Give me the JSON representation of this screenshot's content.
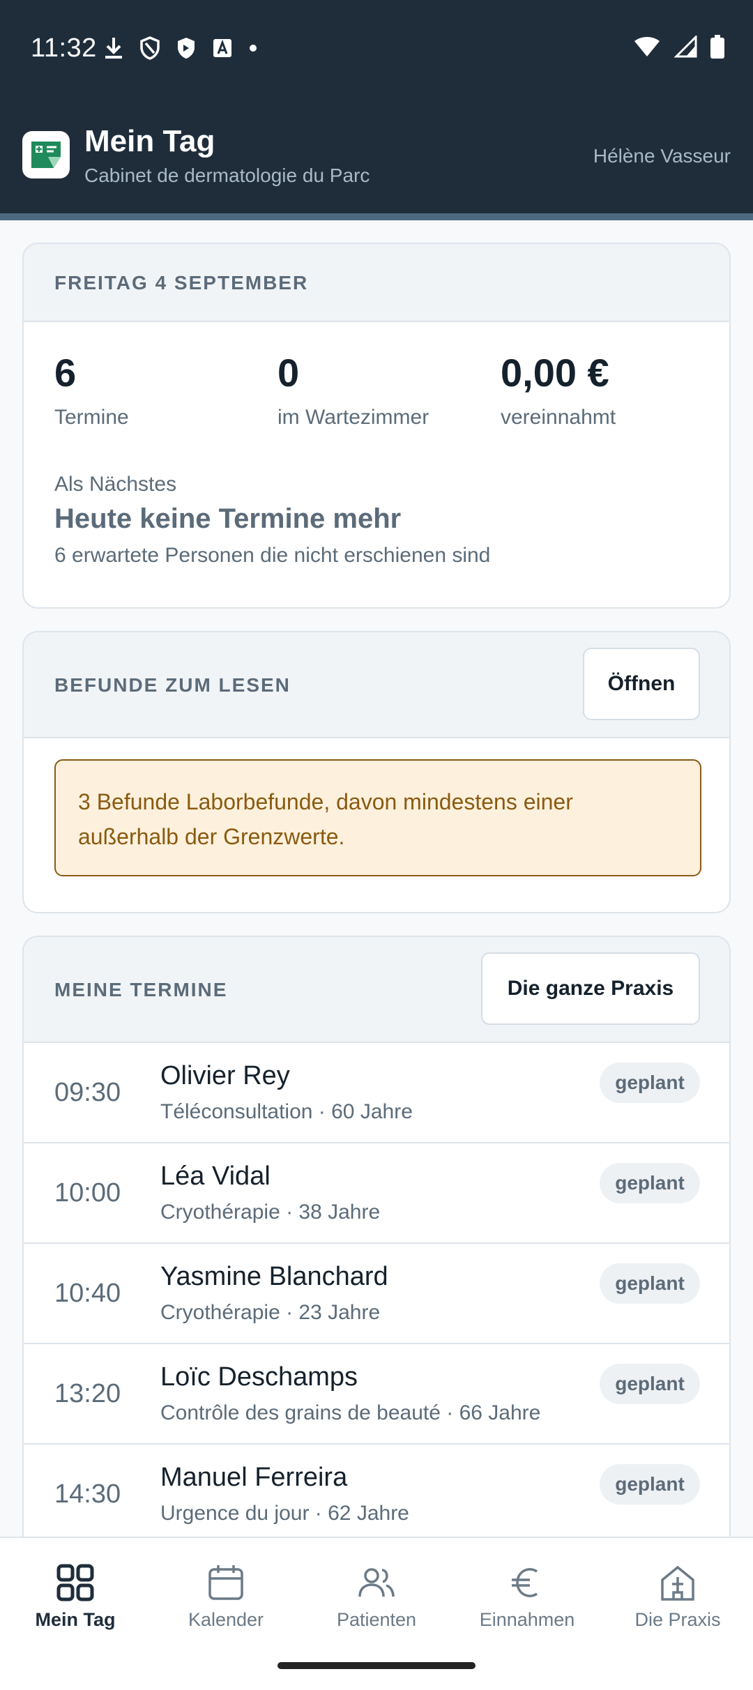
{
  "status_bar": {
    "time": "11:32"
  },
  "header": {
    "title": "Mein Tag",
    "subtitle": "Cabinet de dermatologie du Parc",
    "user": "Hélène Vasseur"
  },
  "day_card": {
    "date": "FREITAG 4 SEPTEMBER",
    "stats": [
      {
        "value": "6",
        "label": "Termine"
      },
      {
        "value": "0",
        "label": "im Wartezimmer"
      },
      {
        "value": "0,00 €",
        "label": "vereinnahmt"
      }
    ],
    "next_label": "Als Nächstes",
    "next_title": "Heute keine Termine mehr",
    "next_sub": "6 erwartete Personen die nicht erschienen sind"
  },
  "results_card": {
    "title": "BEFUNDE ZUM LESEN",
    "button": "Öffnen",
    "alert": "3 Befunde Laborbefunde, davon mindestens einer außerhalb der Grenzwerte."
  },
  "appointments_card": {
    "title": "MEINE TERMINE",
    "button": "Die ganze Praxis",
    "items": [
      {
        "time": "09:30",
        "name": "Olivier Rey",
        "meta": "Téléconsultation · 60 Jahre",
        "status": "geplant"
      },
      {
        "time": "10:00",
        "name": "Léa Vidal",
        "meta": "Cryothérapie · 38 Jahre",
        "status": "geplant"
      },
      {
        "time": "10:40",
        "name": "Yasmine Blanchard",
        "meta": "Cryothérapie · 23 Jahre",
        "status": "geplant"
      },
      {
        "time": "13:20",
        "name": "Loïc Deschamps",
        "meta": "Contrôle des grains de beauté · 66 Jahre",
        "status": "geplant"
      },
      {
        "time": "14:30",
        "name": "Manuel Ferreira",
        "meta": "Urgence du jour · 62 Jahre",
        "status": "geplant"
      }
    ]
  },
  "nav": {
    "items": [
      {
        "label": "Mein Tag",
        "icon": "grid-icon",
        "active": true
      },
      {
        "label": "Kalender",
        "icon": "calendar-icon"
      },
      {
        "label": "Patienten",
        "icon": "people-icon"
      },
      {
        "label": "Einnahmen",
        "icon": "euro-icon"
      },
      {
        "label": "Die Praxis",
        "icon": "building-icon"
      }
    ]
  },
  "colors": {
    "header_bg": "#1f2d3b",
    "accent": "#4c6a80",
    "alert_bg": "#fdf1dd",
    "alert_border": "#8a5a16"
  }
}
